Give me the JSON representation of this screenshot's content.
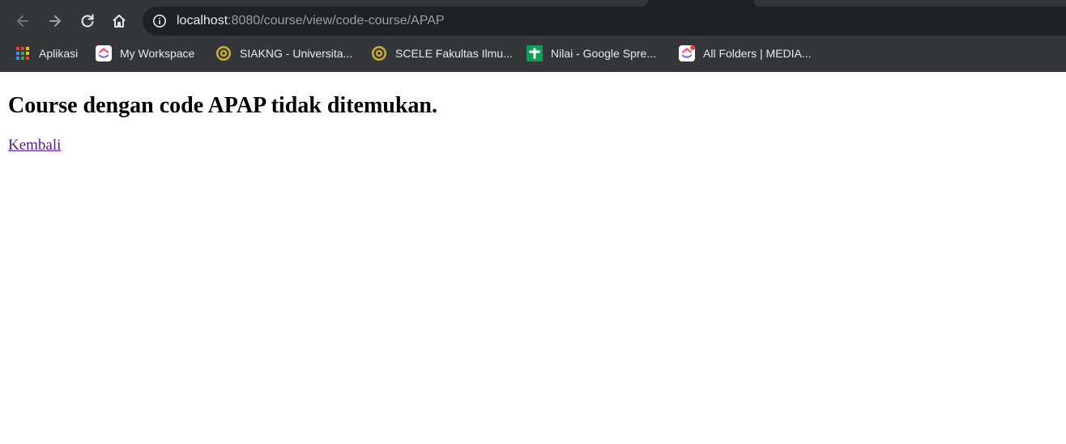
{
  "browser": {
    "url_host": "localhost",
    "url_rest": ":8080/course/view/code-course/APAP",
    "bookmarks": [
      {
        "label": "Aplikasi",
        "icon": "apps-grid-icon"
      },
      {
        "label": "My Workspace",
        "icon": "clickup-icon"
      },
      {
        "label": "SIAKNG - Universita...",
        "icon": "university-seal-icon"
      },
      {
        "label": "SCELE Fakultas Ilmu...",
        "icon": "university-seal-icon"
      },
      {
        "label": "Nilai - Google Spre...",
        "icon": "google-sheets-icon"
      },
      {
        "label": "All Folders | MEDIA...",
        "icon": "clickup-notification-icon"
      }
    ]
  },
  "page": {
    "heading": "Course dengan code APAP tidak ditemukan.",
    "back_link": "Kembali"
  },
  "colors": {
    "chrome_bg": "#35363a",
    "omnibox_bg": "#202124",
    "link": "#551a8b"
  }
}
